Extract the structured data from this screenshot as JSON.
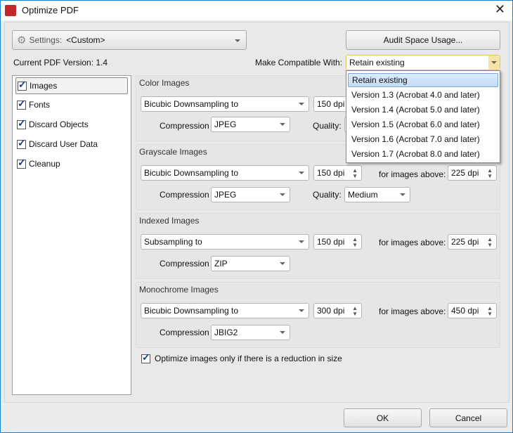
{
  "window": {
    "title": "Optimize PDF"
  },
  "settings": {
    "label": "Settings:",
    "value": "<Custom>"
  },
  "audit_button": "Audit Space Usage...",
  "current_version": "Current PDF Version: 1.4",
  "compat": {
    "label": "Make Compatible With:",
    "value": "Retain existing",
    "options": [
      "Retain existing",
      "Version 1.3 (Acrobat 4.0 and later)",
      "Version 1.4 (Acrobat 5.0 and later)",
      "Version 1.5 (Acrobat 6.0 and later)",
      "Version 1.6 (Acrobat 7.0 and later)",
      "Version 1.7 (Acrobat 8.0 and later)"
    ]
  },
  "sidebar": {
    "items": [
      {
        "label": "Images"
      },
      {
        "label": "Fonts"
      },
      {
        "label": "Discard Objects"
      },
      {
        "label": "Discard User Data"
      },
      {
        "label": "Cleanup"
      }
    ]
  },
  "labels": {
    "compression": "Compression",
    "quality": "Quality:",
    "above": "for images above:"
  },
  "groups": {
    "color": {
      "title": "Color Images",
      "method": "Bicubic Downsampling to",
      "dpi": "150 dpi",
      "compression": "JPEG"
    },
    "gray": {
      "title": "Grayscale Images",
      "method": "Bicubic Downsampling to",
      "dpi": "150 dpi",
      "above": "225 dpi",
      "compression": "JPEG",
      "quality": "Medium"
    },
    "indexed": {
      "title": "Indexed Images",
      "method": "Subsampling to",
      "dpi": "150 dpi",
      "above": "225 dpi",
      "compression": "ZIP"
    },
    "mono": {
      "title": "Monochrome Images",
      "method": "Bicubic Downsampling to",
      "dpi": "300 dpi",
      "above": "450 dpi",
      "compression": "JBIG2"
    }
  },
  "optimize_only": "Optimize images only if there is a reduction in size",
  "ok": "OK",
  "cancel": "Cancel"
}
